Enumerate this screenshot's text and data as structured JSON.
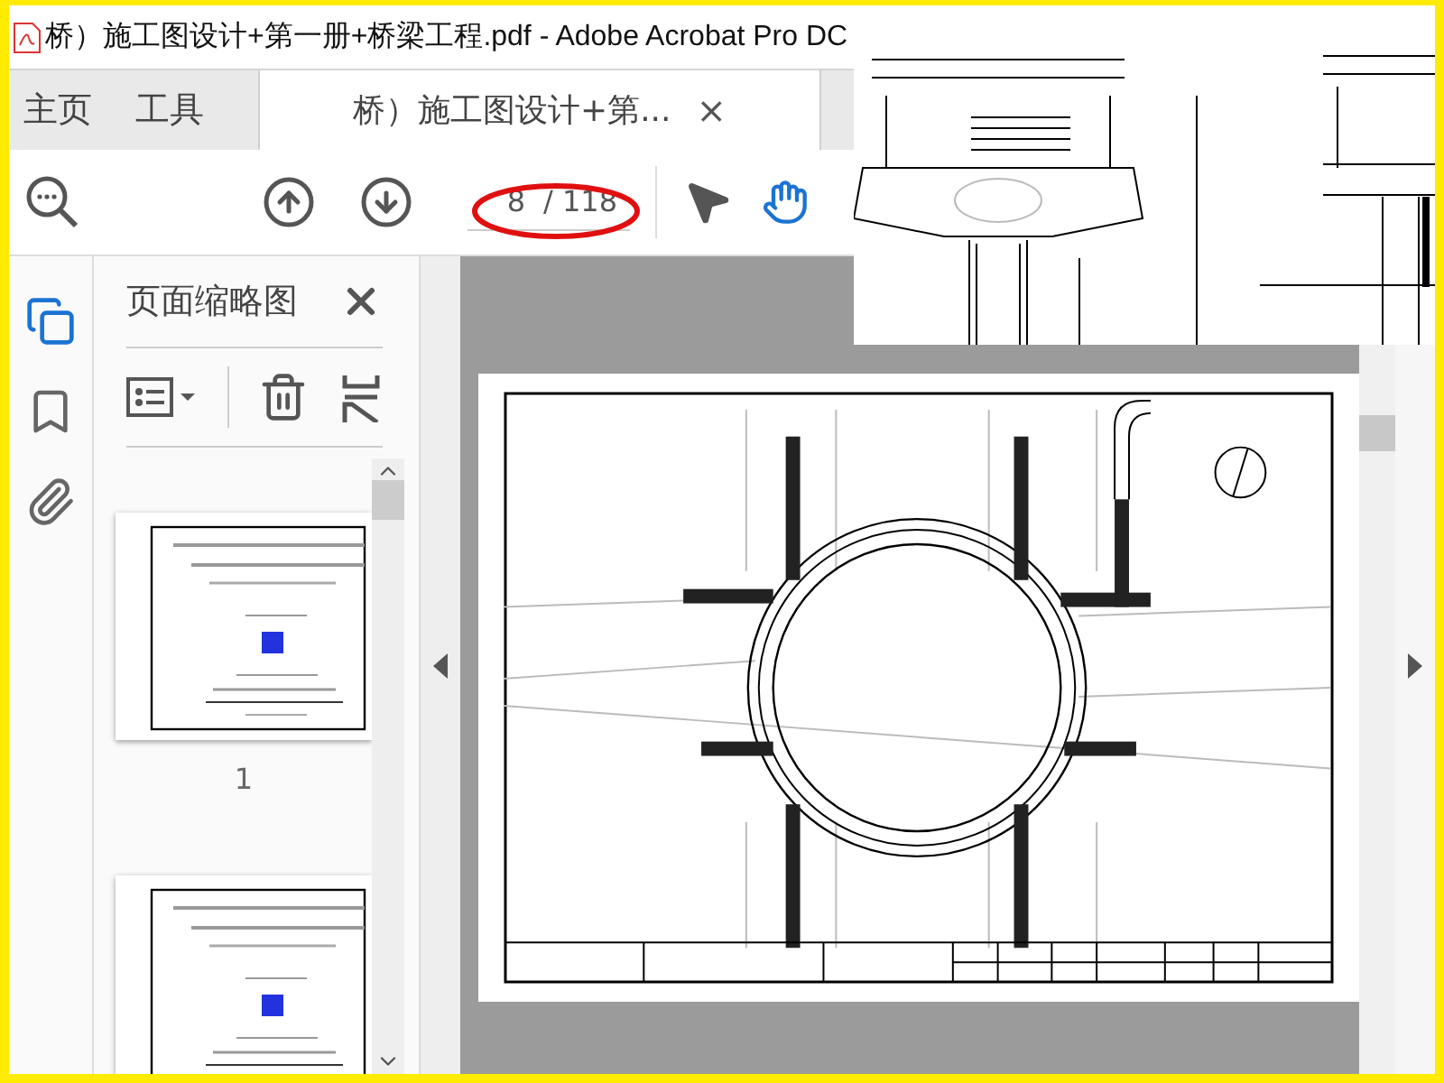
{
  "window": {
    "title": "桥）施工图设计+第一册+桥梁工程.pdf - Adobe Acrobat Pro DC"
  },
  "tabs": [
    {
      "label": "主页",
      "selected": false,
      "kind": "nav"
    },
    {
      "label": "工具",
      "selected": false,
      "kind": "nav"
    },
    {
      "label": "桥）施工图设计+第...",
      "selected": true,
      "kind": "document",
      "close": "×"
    }
  ],
  "page_nav": {
    "value": "8",
    "total": "/ 118"
  },
  "side_rail": [
    {
      "kind": "pages",
      "selected": true
    },
    {
      "kind": "bookmarks",
      "selected": false
    },
    {
      "kind": "attachments",
      "selected": false
    }
  ],
  "thumbnails_panel": {
    "title": "页面缩略图",
    "thumbnails": [
      {
        "label": "1",
        "selected": false
      },
      {
        "selected": false
      }
    ]
  }
}
